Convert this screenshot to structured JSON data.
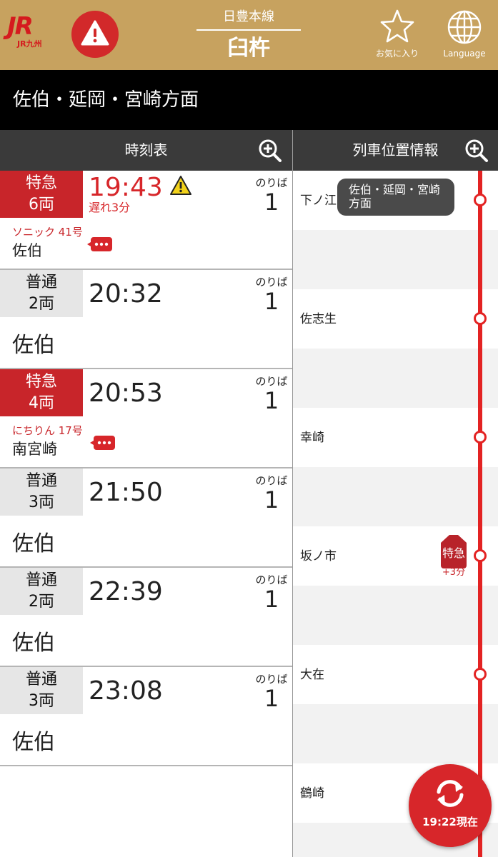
{
  "header": {
    "logo_mark": "JR",
    "logo_sub": "JR九州",
    "line_name": "日豊本線",
    "station_name": "臼杵",
    "favorites_label": "お気に入り",
    "language_label": "Language"
  },
  "direction": "佐伯・延岡・宮崎方面",
  "columns": {
    "timetable": "時刻表",
    "train_position": "列車位置情報"
  },
  "platform_label": "のりば",
  "departures": [
    {
      "type": "特急",
      "cars": "6両",
      "time": "19:43",
      "delay": "遅れ3分",
      "platform": "1",
      "train_name": "ソニック 41号",
      "destination": "佐伯"
    },
    {
      "type": "普通",
      "cars": "2両",
      "time": "20:32",
      "platform": "1",
      "destination": "佐伯"
    },
    {
      "type": "特急",
      "cars": "4両",
      "time": "20:53",
      "platform": "1",
      "train_name": "にちりん 17号",
      "destination": "南宮崎"
    },
    {
      "type": "普通",
      "cars": "3両",
      "time": "21:50",
      "platform": "1",
      "destination": "佐伯"
    },
    {
      "type": "普通",
      "cars": "2両",
      "time": "22:39",
      "platform": "1",
      "destination": "佐伯"
    },
    {
      "type": "普通",
      "cars": "3両",
      "time": "23:08",
      "platform": "1",
      "destination": "佐伯"
    }
  ],
  "positions": {
    "tooltip": "佐伯・延岡・宮崎方面",
    "stations": [
      "下ノ江",
      "佐志生",
      "幸崎",
      "坂ノ市",
      "大在",
      "鶴崎"
    ],
    "train": {
      "type": "特急",
      "delay": "+3分"
    }
  },
  "refresh": {
    "label": "19:22現在"
  },
  "colors": {
    "header_gold": "#c7a25f",
    "accent_red": "#d7262a",
    "express_red": "#c8252a",
    "dark_header": "#3a3a3a"
  },
  "icons": [
    "warning-icon",
    "star-icon",
    "globe-icon",
    "zoom-in-icon",
    "chat-icon",
    "refresh-icon"
  ]
}
